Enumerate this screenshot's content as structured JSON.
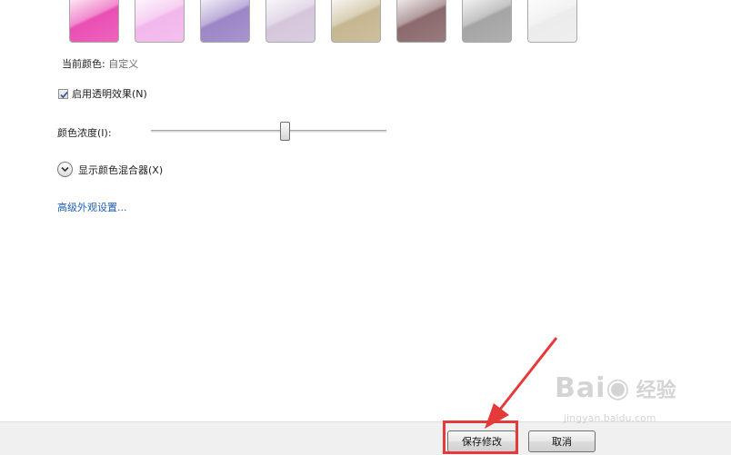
{
  "swatches": [
    {
      "name": "pink",
      "color": "#ea4fb4"
    },
    {
      "name": "light-pink",
      "color": "#f2b7ec"
    },
    {
      "name": "lavender",
      "color": "#9c86c7"
    },
    {
      "name": "pale-lilac",
      "color": "#d5c6dc"
    },
    {
      "name": "khaki",
      "color": "#c6b790"
    },
    {
      "name": "mauve-brown",
      "color": "#8b6a6c"
    },
    {
      "name": "gray",
      "color": "#a5a5a5"
    },
    {
      "name": "white",
      "color": "#ececec"
    }
  ],
  "current_color": {
    "label": "当前颜色:",
    "value": "自定义"
  },
  "transparency": {
    "label": "启用透明效果(N)",
    "checked": true
  },
  "intensity": {
    "label": "颜色浓度(I):",
    "value_percent": 57
  },
  "mixer": {
    "label": "显示颜色混合器(X)",
    "icon": "chevron-down-icon"
  },
  "advanced_link": "高级外观设置...",
  "footer": {
    "save_label": "保存修改",
    "cancel_label": "取消"
  },
  "annotation": {
    "highlight_color": "#e53a3a"
  },
  "watermark": {
    "brand": "Bai",
    "brand2": "经验",
    "url": "jingyan.baidu.com"
  }
}
